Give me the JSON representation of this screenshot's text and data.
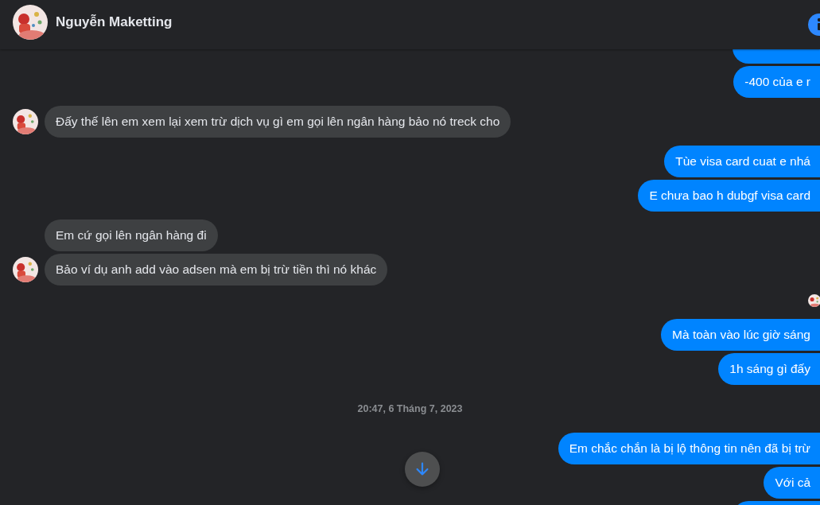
{
  "header": {
    "name": "Nguyễn Maketting"
  },
  "messages": [
    {
      "kind": "out_cut"
    },
    {
      "kind": "out",
      "text": "-400 của e r"
    },
    {
      "kind": "in",
      "text": "Đấy thế lên em xem lại xem trừ dịch vụ gì em gọi lên ngân hàng bảo nó treck cho",
      "avatar": true
    },
    {
      "kind": "out",
      "text": "Tùe visa card cuat e nhá"
    },
    {
      "kind": "out",
      "text": "E chưa bao h dubgf visa card"
    },
    {
      "kind": "in",
      "text": "Em cứ gọi lên ngân hàng đi",
      "avatar": false
    },
    {
      "kind": "in",
      "text": "Bảo ví dụ anh add vào adsen mà em bị trừ tiền thì nó khác",
      "avatar": true
    },
    {
      "kind": "seen"
    },
    {
      "kind": "out",
      "text": "Mà toàn vào lúc giờ sáng"
    },
    {
      "kind": "out",
      "text": "1h sáng gì đấy"
    },
    {
      "kind": "time",
      "text": "20:47, 6 Tháng 7, 2023"
    },
    {
      "kind": "out",
      "text": "Em chắc chắn là bị lộ thông tin nên đã bị trừ"
    },
    {
      "kind": "out",
      "text": "Với cả"
    },
    {
      "kind": "out_cut"
    }
  ]
}
